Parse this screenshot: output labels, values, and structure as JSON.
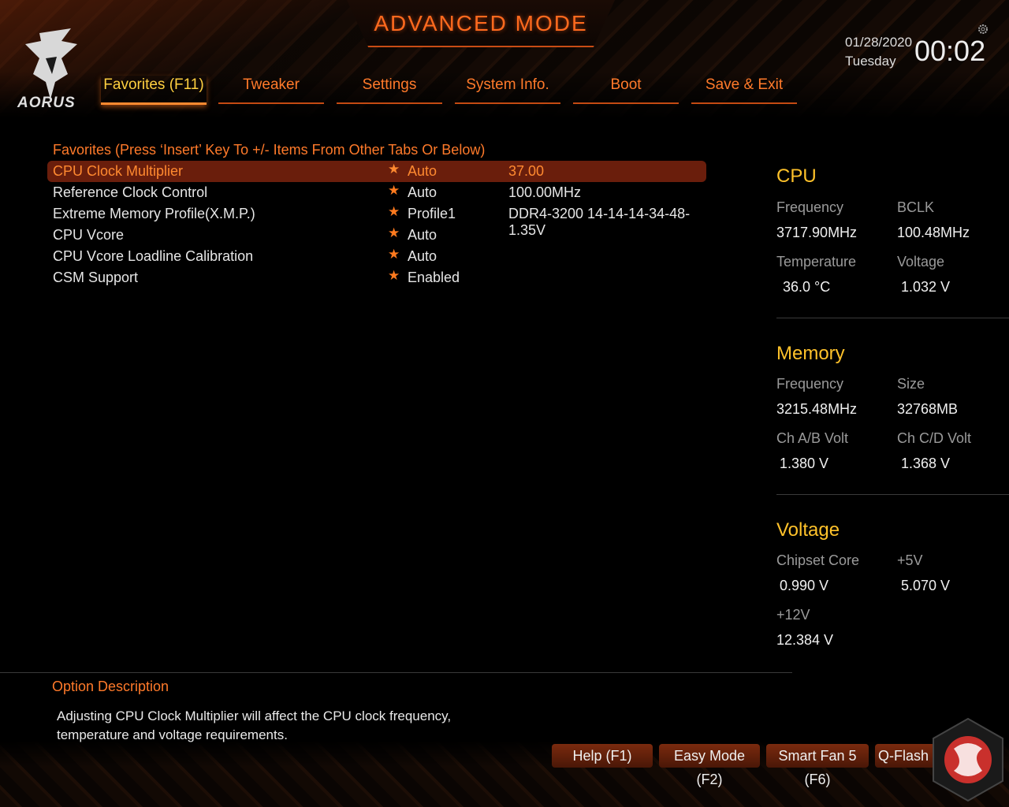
{
  "header": {
    "mode_title": "ADVANCED MODE",
    "logo_text": "AORUS",
    "date": "01/28/2020",
    "weekday": "Tuesday",
    "time": "00:02"
  },
  "tabs": [
    {
      "label": "Favorites (F11)",
      "active": true
    },
    {
      "label": "Tweaker"
    },
    {
      "label": "Settings"
    },
    {
      "label": "System Info."
    },
    {
      "label": "Boot"
    },
    {
      "label": "Save & Exit"
    }
  ],
  "favorites": {
    "header": "Favorites (Press ‘Insert’ Key To +/- Items From Other Tabs Or Below)",
    "items": [
      {
        "name": "CPU Clock Multiplier",
        "value": "Auto",
        "extra": "37.00",
        "selected": true
      },
      {
        "name": "Reference Clock Control",
        "value": "Auto",
        "extra": "100.00MHz"
      },
      {
        "name": "Extreme Memory Profile(X.M.P.)",
        "value": "Profile1",
        "extra": "DDR4-3200 14-14-14-34-48-1.35V"
      },
      {
        "name": "CPU Vcore",
        "value": "Auto",
        "extra": ""
      },
      {
        "name": "CPU Vcore Loadline Calibration",
        "value": "Auto",
        "extra": ""
      },
      {
        "name": "CSM Support",
        "value": "Enabled",
        "extra": ""
      }
    ]
  },
  "info": {
    "cpu": {
      "title": "CPU",
      "frequency_label": "Frequency",
      "frequency": "3717.90MHz",
      "bclk_label": "BCLK",
      "bclk": "100.48MHz",
      "temperature_label": "Temperature",
      "temperature": "36.0 °C",
      "voltage_label": "Voltage",
      "voltage": "1.032 V"
    },
    "memory": {
      "title": "Memory",
      "frequency_label": "Frequency",
      "frequency": "3215.48MHz",
      "size_label": "Size",
      "size": "32768MB",
      "chab_label": "Ch A/B Volt",
      "chab": "1.380 V",
      "chcd_label": "Ch C/D Volt",
      "chcd": "1.368 V"
    },
    "voltage": {
      "title": "Voltage",
      "chipset_label": "Chipset Core",
      "chipset": "0.990 V",
      "v5_label": "+5V",
      "v5": "5.070 V",
      "v12_label": "+12V",
      "v12": "12.384 V"
    }
  },
  "description": {
    "title": "Option Description",
    "text": "Adjusting CPU Clock Multiplier will affect the CPU clock frequency, temperature and voltage requirements."
  },
  "buttons": {
    "help": "Help (F1)",
    "easy_mode": "Easy Mode (F2)",
    "smart_fan": "Smart Fan 5 (F6)",
    "qflash": "Q-Flash (F8)"
  },
  "colors": {
    "accent": "#ff7a2a",
    "title_yellow": "#ffc22a",
    "selected_row": "#6a1e0c"
  }
}
